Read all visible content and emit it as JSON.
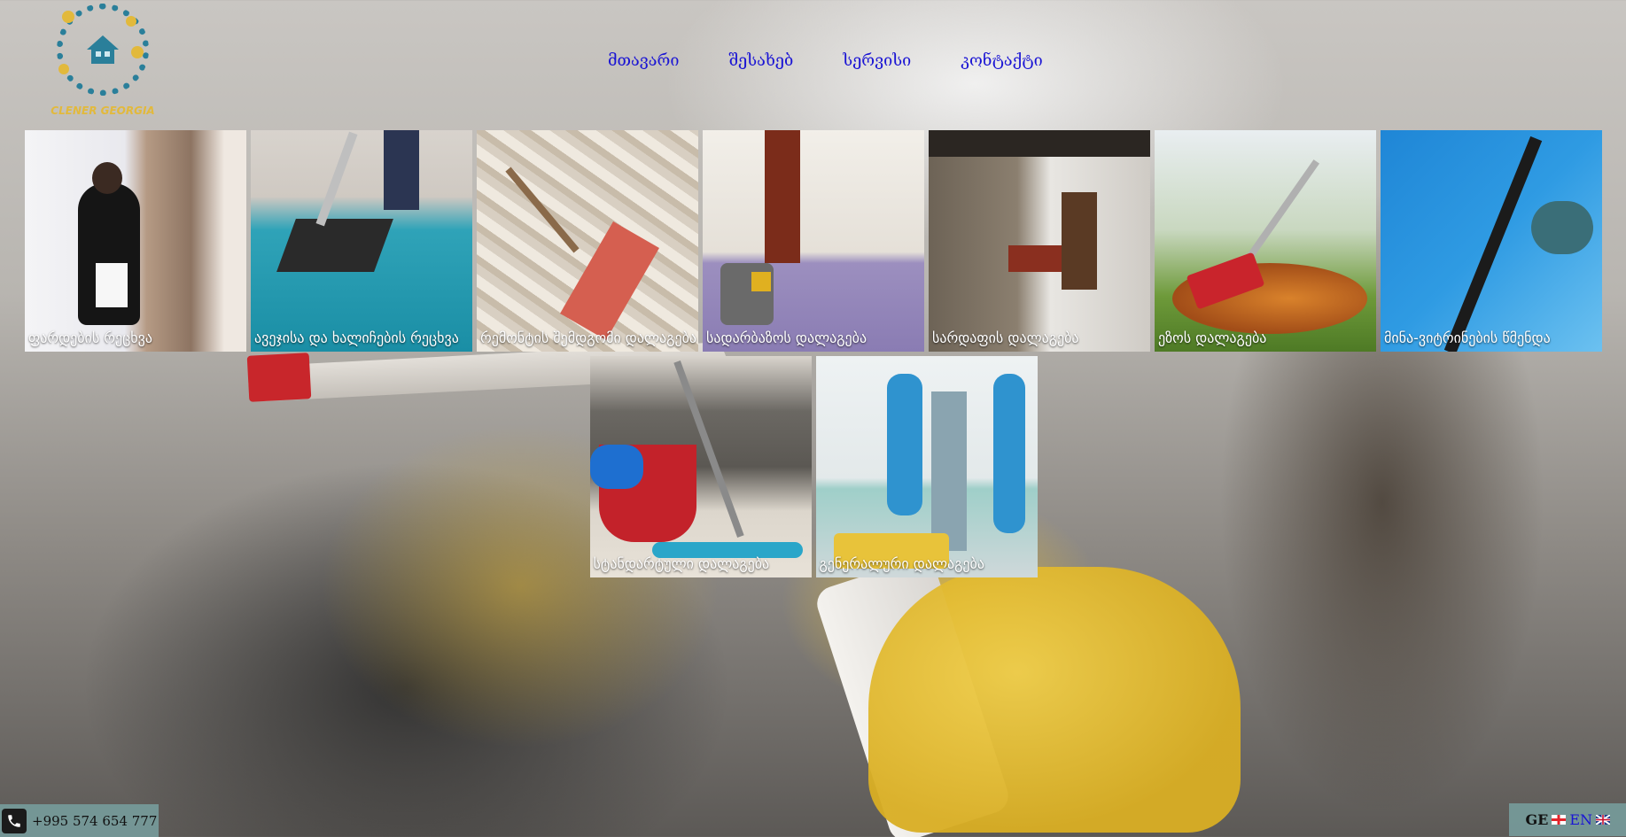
{
  "header": {
    "logo_text": "CLENER GEORGIA"
  },
  "nav": {
    "items": [
      {
        "label": "მთავარი"
      },
      {
        "label": "შესახებ"
      },
      {
        "label": "სერვისი"
      },
      {
        "label": "კონტაქტი"
      }
    ]
  },
  "services": {
    "row1": [
      {
        "label": "ფარდების რეცხვა",
        "icon": "curtain-cleaning-image"
      },
      {
        "label": "ავეჯისა და ხალიჩების რეცხვა",
        "icon": "carpet-cleaning-image"
      },
      {
        "label": "რემონტის შემდგომი დალაგება",
        "icon": "post-renovation-image"
      },
      {
        "label": "სადარბაზოს დალაგება",
        "icon": "hallway-cleaning-image"
      },
      {
        "label": "სარდაფის დალაგება",
        "icon": "basement-cleaning-image"
      },
      {
        "label": "ეზოს დალაგება",
        "icon": "yard-cleaning-image"
      },
      {
        "label": "მინა-ვიტრინების წმენდა",
        "icon": "window-cleaning-image"
      }
    ],
    "row2": [
      {
        "label": "სტანდარტული დალაგება",
        "icon": "standard-cleaning-image"
      },
      {
        "label": "გენერალური დალაგება",
        "icon": "general-cleaning-image"
      }
    ]
  },
  "contact": {
    "phone": "+995 574 654 777"
  },
  "language": {
    "current": "GE",
    "other": "EN"
  },
  "colors": {
    "nav_link": "#1a14d4",
    "logo_text": "#e2b93c",
    "footer_bg": "#78a0a0"
  }
}
